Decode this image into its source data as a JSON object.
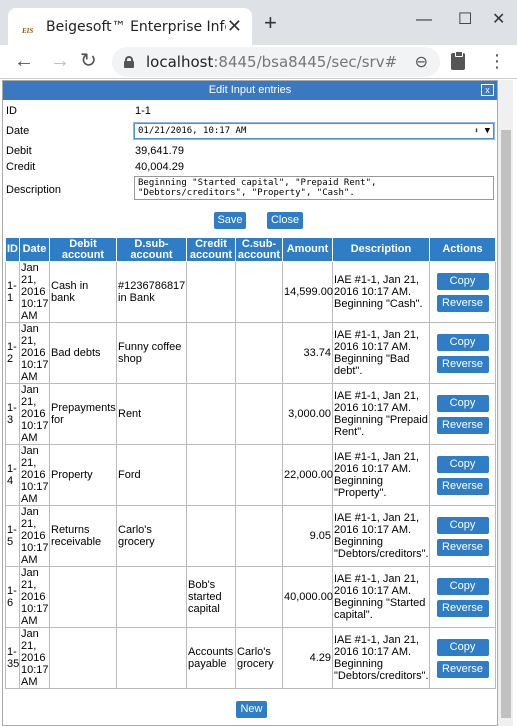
{
  "browser": {
    "tab_title": "Beigesoft™ Enterprise Info",
    "favicon_text": "EIS",
    "url_host": "localhost",
    "url_path": ":8445/bsa8445/sec/srv#"
  },
  "dialog": {
    "title": "Edit Input entries",
    "close_label": "x",
    "fields": {
      "id_label": "ID",
      "id_value": "1-1",
      "date_label": "Date",
      "date_value": "01/21/2016, 10:17 AM",
      "debit_label": "Debit",
      "debit_value": "39,641.79",
      "credit_label": "Credit",
      "credit_value": "40,004.29",
      "description_label": "Description",
      "description_value": "Beginning \"Started capital\", \"Prepaid Rent\", \"Debtors/creditors\", \"Property\", \"Cash\"."
    },
    "save_label": "Save",
    "close_button_label": "Close",
    "new_label": "New"
  },
  "table": {
    "headers": [
      "ID",
      "Date",
      "Debit account",
      "D.sub-account",
      "Credit account",
      "C.sub-account",
      "Amount",
      "Description",
      "Actions"
    ],
    "copy_label": "Copy",
    "reverse_label": "Reverse",
    "rows": [
      {
        "id": "1-1",
        "date": "Jan 21, 2016 10:17 AM",
        "debit_account": "Cash in bank",
        "d_sub": "#1236786817 in Bank",
        "credit_account": "",
        "c_sub": "",
        "amount": "14,599.00",
        "description": "IAE #1-1, Jan 21, 2016 10:17 AM. Beginning \"Cash\"."
      },
      {
        "id": "1-2",
        "date": "Jan 21, 2016 10:17 AM",
        "debit_account": "Bad debts",
        "d_sub": "Funny coffee shop",
        "credit_account": "",
        "c_sub": "",
        "amount": "33.74",
        "description": "IAE #1-1, Jan 21, 2016 10:17 AM. Beginning \"Bad debt\"."
      },
      {
        "id": "1-3",
        "date": "Jan 21, 2016 10:17 AM",
        "debit_account": "Prepayments for",
        "d_sub": "Rent",
        "credit_account": "",
        "c_sub": "",
        "amount": "3,000.00",
        "description": "IAE #1-1, Jan 21, 2016 10:17 AM. Beginning \"Prepaid Rent\"."
      },
      {
        "id": "1-4",
        "date": "Jan 21, 2016 10:17 AM",
        "debit_account": "Property",
        "d_sub": "Ford",
        "credit_account": "",
        "c_sub": "",
        "amount": "22,000.00",
        "description": "IAE #1-1, Jan 21, 2016 10:17 AM. Beginning \"Property\"."
      },
      {
        "id": "1-5",
        "date": "Jan 21, 2016 10:17 AM",
        "debit_account": "Returns receivable",
        "d_sub": "Carlo's grocery",
        "credit_account": "",
        "c_sub": "",
        "amount": "9.05",
        "description": "IAE #1-1, Jan 21, 2016 10:17 AM. Beginning \"Debtors/creditors\"."
      },
      {
        "id": "1-6",
        "date": "Jan 21, 2016 10:17 AM",
        "debit_account": "",
        "d_sub": "",
        "credit_account": "Bob's started capital",
        "c_sub": "",
        "amount": "40,000.00",
        "description": "IAE #1-1, Jan 21, 2016 10:17 AM. Beginning \"Started capital\"."
      },
      {
        "id": "1-35",
        "date": "Jan 21, 2016 10:17 AM",
        "debit_account": "",
        "d_sub": "",
        "credit_account": "Accounts payable",
        "c_sub": "Carlo's grocery",
        "amount": "4.29",
        "description": "IAE #1-1, Jan 21, 2016 10:17 AM. Beginning \"Debtors/creditors\"."
      }
    ]
  },
  "colors": {
    "accent": "#2e7dc6",
    "title_bar": "#3a78c2"
  },
  "icons": [
    "back-arrow-icon",
    "forward-arrow-icon",
    "reload-icon",
    "lock-icon",
    "zoom-icon",
    "clipboard-icon",
    "menu-icon",
    "close-icon",
    "minimize-icon",
    "maximize-icon"
  ]
}
